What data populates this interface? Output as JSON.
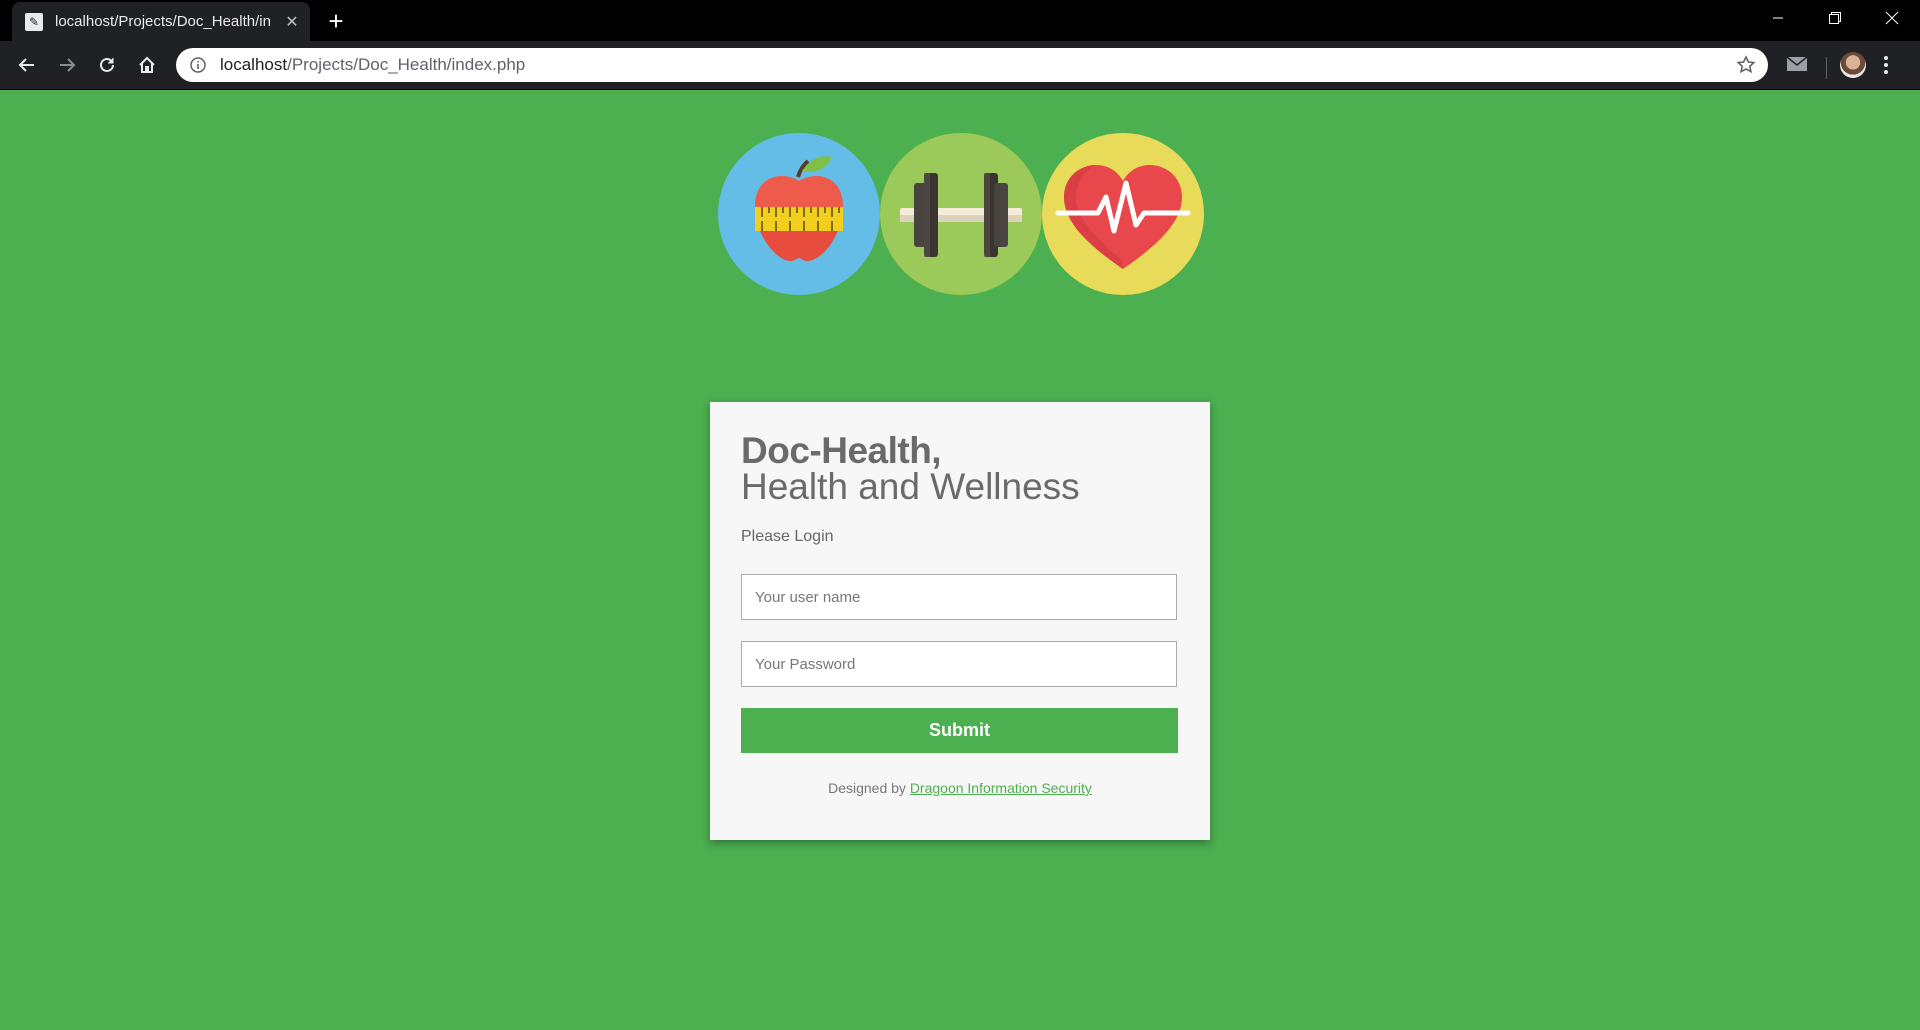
{
  "browser": {
    "tab_title": "localhost/Projects/Doc_Health/in",
    "url_host": "localhost",
    "url_path": "/Projects/Doc_Health/index.php"
  },
  "logos": [
    {
      "name": "apple-measuring-tape",
      "bg": "#63bde6"
    },
    {
      "name": "dumbbell",
      "bg": "#9bc95a"
    },
    {
      "name": "heart-pulse",
      "bg": "#e8db5a"
    }
  ],
  "login": {
    "title": "Doc-Health,",
    "subtitle": "Health and Wellness",
    "prompt": "Please Login",
    "username_placeholder": "Your user name",
    "password_placeholder": "Your Password",
    "submit_label": "Submit",
    "credit_prefix": "Designed by",
    "credit_link": "Dragoon Information Security"
  },
  "colors": {
    "page_bg": "#4caf50",
    "accent": "#4caf50"
  }
}
